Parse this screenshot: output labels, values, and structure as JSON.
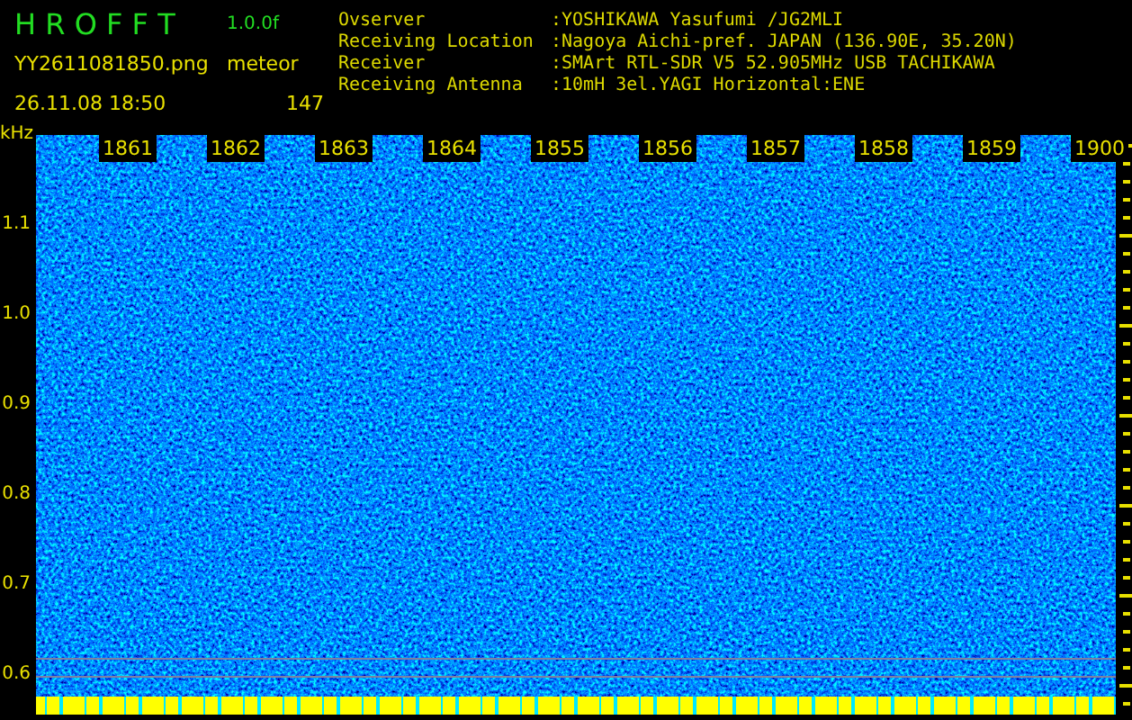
{
  "app": {
    "title": "H R O F F T",
    "version": "1.0.0f",
    "filename": "YY2611081850.png",
    "datetime": "26.11.08 18:50",
    "mode": "meteor",
    "count": "147"
  },
  "station": [
    {
      "label": "Ovserver",
      "value": ":YOSHIKAWA Yasufumi /JG2MLI"
    },
    {
      "label": "Receiving Location",
      "value": ":Nagoya Aichi-pref. JAPAN (136.90E, 35.20N)"
    },
    {
      "label": "Receiver",
      "value": ":SMArt RTL-SDR V5 52.905MHz USB TACHIKAWA"
    },
    {
      "label": "Receiving Antenna",
      "value": ":10mH 3el.YAGI Horizontal:ENE"
    }
  ],
  "frequency_axis": {
    "unit": "kHz",
    "ticks": [
      "1.1",
      "1.0",
      "0.9",
      "0.8",
      "0.7",
      "0.6"
    ]
  },
  "time_labels": [
    "1861",
    "1862",
    "1863",
    "1864",
    "1855",
    "1856",
    "1857",
    "1858",
    "1859",
    "1900"
  ]
}
